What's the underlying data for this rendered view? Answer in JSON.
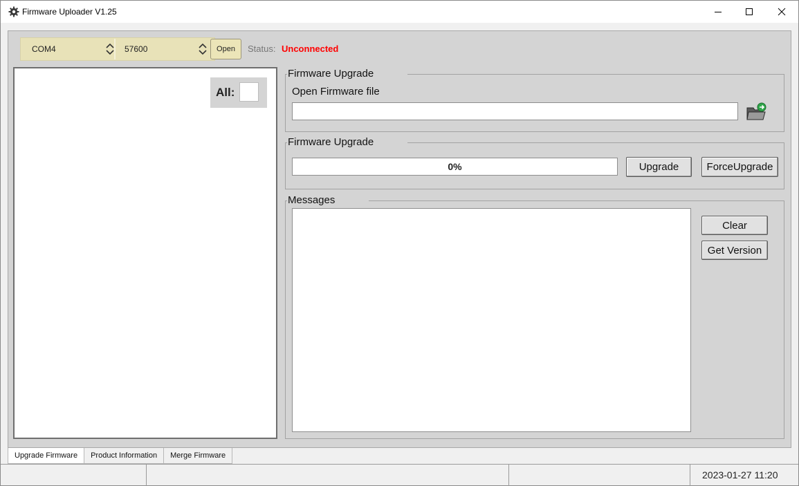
{
  "window": {
    "title": "Firmware Uploader V1.25",
    "icon": "gear-icon"
  },
  "serial": {
    "port": "COM4",
    "baud": "57600",
    "open_label": "Open",
    "status_label": "Status:",
    "status_value": "Unconnected",
    "status_color": "#ff0000"
  },
  "device_list": {
    "all_label": "All:"
  },
  "firmware_file": {
    "group_title": "Firmware Upgrade",
    "open_label": "Open Firmware file",
    "file_value": "",
    "browse_icon": "folder-open-icon"
  },
  "upgrade": {
    "group_title": "Firmware Upgrade",
    "progress_text": "0%",
    "progress_fraction": 0,
    "upgrade_label": "Upgrade",
    "force_label": "ForceUpgrade"
  },
  "messages": {
    "group_title": "Messages",
    "content": "",
    "clear_label": "Clear",
    "get_version_label": "Get Version"
  },
  "tabs": [
    {
      "label": "Upgrade Firmware",
      "active": true
    },
    {
      "label": "Product Information",
      "active": false
    },
    {
      "label": "Merge Firmware",
      "active": false
    }
  ],
  "statusbar": {
    "datetime": "2023-01-27 11:20"
  }
}
